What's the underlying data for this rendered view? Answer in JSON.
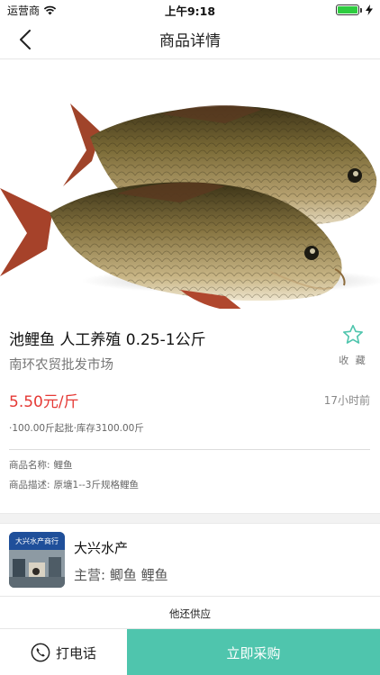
{
  "status_bar": {
    "carrier": "运营商",
    "time": "上午9:18",
    "battery_level": 1.0,
    "icons": [
      "wifi-icon",
      "battery-icon",
      "charging-icon"
    ]
  },
  "nav": {
    "title": "商品详情",
    "back_icon": "chevron-left-icon"
  },
  "product": {
    "title": "池鲤鱼 人工养殖 0.25-1公斤",
    "market": "南环农贸批发市场",
    "favorite_label": "收 藏",
    "favorite_icon": "star-outline-icon",
    "price": "5.50元/斤",
    "posted_time": "17小时前",
    "stock_info": "·100.00斤起批·库存3100.00斤",
    "specs": [
      {
        "label": "商品名称:",
        "value": "鲤鱼"
      },
      {
        "label": "商品描述:",
        "value": "原塘1--3斤规格鲤鱼"
      }
    ]
  },
  "seller": {
    "name": "大兴水产",
    "main_business": "主营: 鲫鱼 鲤鱼",
    "thumb_sign_text": "大兴水产商行"
  },
  "also_supply_label": "他还供应",
  "bottom": {
    "call_label": "打电话",
    "call_icon": "phone-icon",
    "buy_label": "立即采购"
  },
  "colors": {
    "accent": "#4fc5ad",
    "price": "#e53935",
    "star": "#4fc5ad"
  }
}
